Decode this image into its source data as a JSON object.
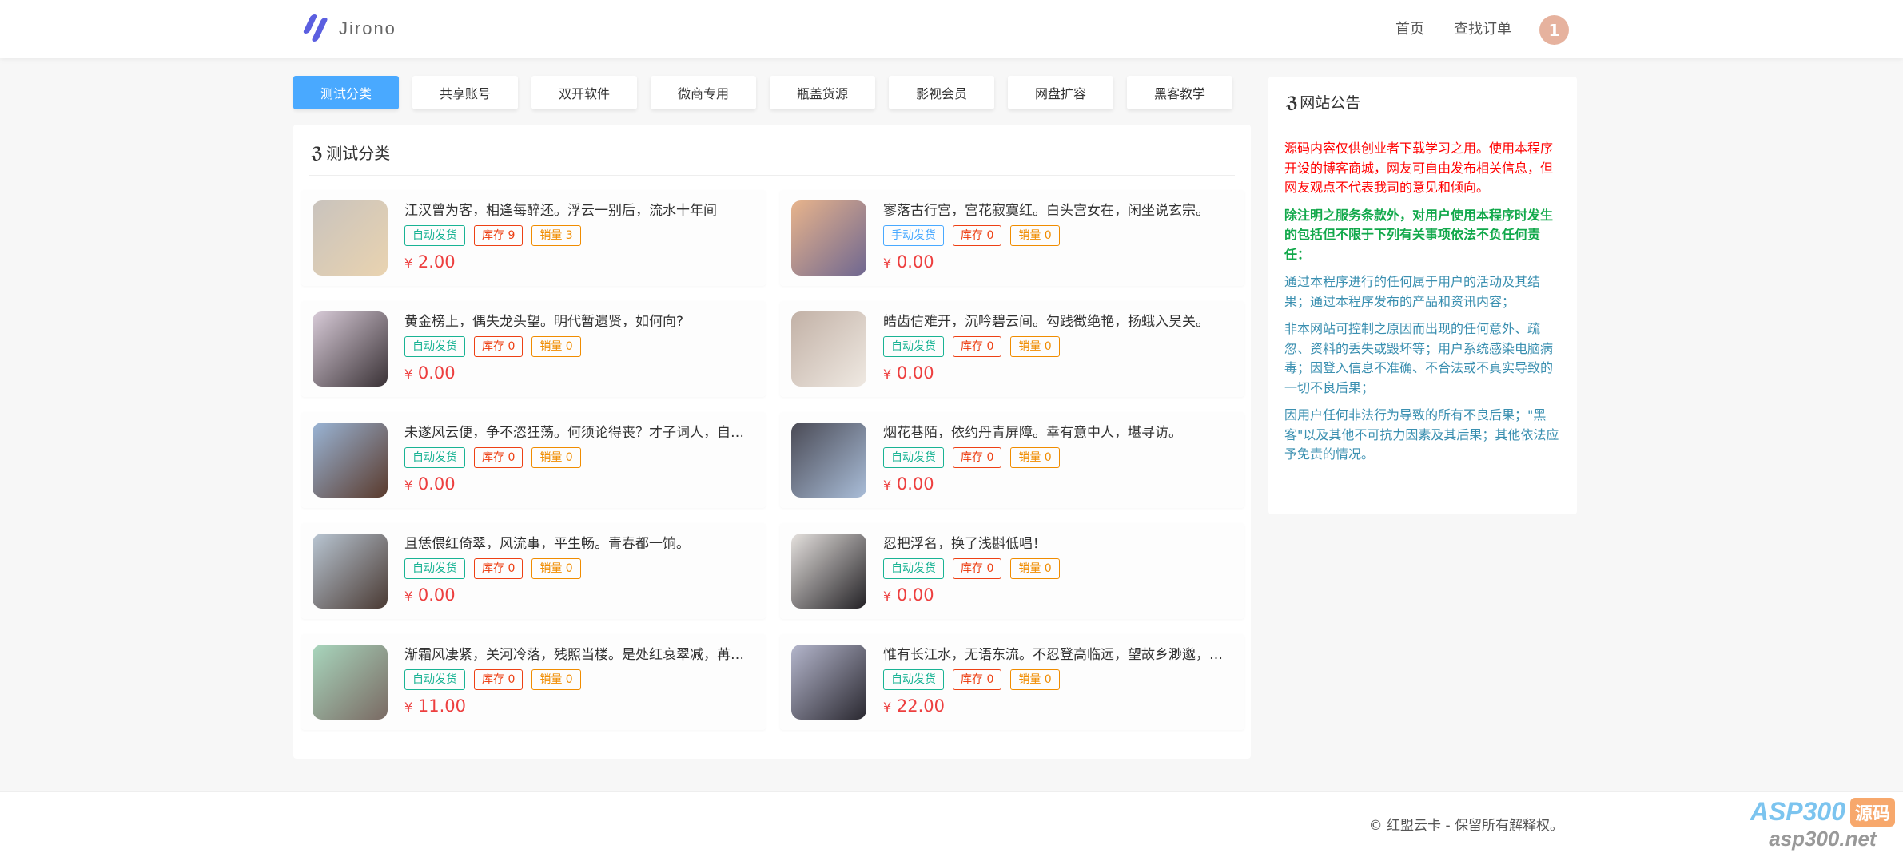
{
  "header": {
    "brand": "Jirono",
    "nav": [
      "首页",
      "查找订单"
    ],
    "avatar_text": "1"
  },
  "tabs": [
    {
      "label": "测试分类",
      "active": true
    },
    {
      "label": "共享账号"
    },
    {
      "label": "双开软件"
    },
    {
      "label": "微商专用"
    },
    {
      "label": "瓶盖货源"
    },
    {
      "label": "影视会员"
    },
    {
      "label": "网盘扩容"
    },
    {
      "label": "黑客教学"
    }
  ],
  "main": {
    "title_icon": "css3-icon",
    "title": "测试分类",
    "items": [
      {
        "title": "江汉曾为客，相逢每醉还。浮云一别后，流水十年间",
        "delivery": "自动发货",
        "delivery_type": "auto",
        "stock": "库存 9",
        "sales": "销量 3",
        "currency": "¥",
        "price": "2.00",
        "colors": [
          "#c9c3bd",
          "#e9d3b0"
        ]
      },
      {
        "title": "寥落古行宫，宫花寂寞红。白头宫女在，闲坐说玄宗。",
        "delivery": "手动发货",
        "delivery_type": "manual",
        "stock": "库存 0",
        "sales": "销量 0",
        "currency": "¥",
        "price": "0.00",
        "colors": [
          "#e8b48c",
          "#6f6790"
        ]
      },
      {
        "title": "黄金榜上，偶失龙头望。明代暂遗贤，如何向?",
        "delivery": "自动发货",
        "delivery_type": "auto",
        "stock": "库存 0",
        "sales": "销量 0",
        "currency": "¥",
        "price": "0.00",
        "colors": [
          "#d8cbd8",
          "#3a3236"
        ]
      },
      {
        "title": "皓齿信难开，沉吟碧云间。勾践徵绝艳，扬蛾入吴关。",
        "delivery": "自动发货",
        "delivery_type": "auto",
        "stock": "库存 0",
        "sales": "销量 0",
        "currency": "¥",
        "price": "0.00",
        "colors": [
          "#c2b1a6",
          "#efe9e2"
        ]
      },
      {
        "title": "未遂风云便，争不恣狂荡。何须论得丧？才子词人，自是白衣卿相。",
        "delivery": "自动发货",
        "delivery_type": "auto",
        "stock": "库存 0",
        "sales": "销量 0",
        "currency": "¥",
        "price": "0.00",
        "colors": [
          "#9ab5d6",
          "#5a3a2c"
        ]
      },
      {
        "title": "烟花巷陌，依约丹青屏障。幸有意中人，堪寻访。",
        "delivery": "自动发货",
        "delivery_type": "auto",
        "stock": "库存 0",
        "sales": "销量 0",
        "currency": "¥",
        "price": "0.00",
        "colors": [
          "#4a4a55",
          "#a9bdd8"
        ]
      },
      {
        "title": "且恁偎红倚翠，风流事，平生畅。青春都一饷。",
        "delivery": "自动发货",
        "delivery_type": "auto",
        "stock": "库存 0",
        "sales": "销量 0",
        "currency": "¥",
        "price": "0.00",
        "colors": [
          "#b9c6d3",
          "#4a3a33"
        ]
      },
      {
        "title": "忍把浮名，换了浅斟低唱！",
        "delivery": "自动发货",
        "delivery_type": "auto",
        "stock": "库存 0",
        "sales": "销量 0",
        "currency": "¥",
        "price": "0.00",
        "colors": [
          "#e5e1de",
          "#232125"
        ]
      },
      {
        "title": "渐霜风凄紧，关河冷落，残照当楼。是处红衰翠减，苒苒物华休。",
        "delivery": "自动发货",
        "delivery_type": "auto",
        "stock": "库存 0",
        "sales": "销量 0",
        "currency": "¥",
        "price": "11.00",
        "colors": [
          "#a8d6bd",
          "#7a6a63"
        ]
      },
      {
        "title": "惟有长江水，无语东流。不忍登高临远，望故乡渺邈，归思难收。",
        "delivery": "自动发货",
        "delivery_type": "auto",
        "stock": "库存 0",
        "sales": "销量 0",
        "currency": "¥",
        "price": "22.00",
        "colors": [
          "#b4b6cc",
          "#2a2830"
        ]
      }
    ]
  },
  "sidebar": {
    "title_icon": "css3-icon",
    "title": "网站公告",
    "paragraphs": [
      {
        "text": "源码内容仅供创业者下载学习之用。使用本程序开设的博客商城，网友可自由发布相关信息，但网友观点不代表我司的意见和倾向。",
        "color": "#ff0000",
        "bold": false
      },
      {
        "text": "除注明之服务条款外，对用户使用本程序时发生的包括但不限于下列有关事项依法不负任何责任：",
        "color": "#11a84a",
        "bold": true
      },
      {
        "text": "通过本程序进行的任何属于用户的活动及其结果；通过本程序发布的产品和资讯内容；",
        "color": "#3a8fb0",
        "bold": false
      },
      {
        "text": "非本网站可控制之原因而出现的任何意外、疏忽、资料的丢失或毁坏等；用户系统感染电脑病毒；因登入信息不准确、不合法或不真实导致的一切不良后果；",
        "color": "#3a8fb0",
        "bold": false
      },
      {
        "text": "因用户任何非法行为导致的所有不良后果；\"黑客\"以及其他不可抗力因素及其后果；其他依法应予免责的情况。",
        "color": "#3a8fb0",
        "bold": false
      }
    ]
  },
  "footer": {
    "copyright": "© 红盟云卡 - 保留所有解释权。"
  },
  "watermark": {
    "line1": "ASP300",
    "badge": "源码",
    "line2": "asp300.net"
  },
  "colors": {
    "accent": "#49a9ff",
    "auto": "#19b394",
    "manual": "#49a9ff",
    "stock": "#ed4014",
    "sales": "#f08c00",
    "price": "#ed3f3f",
    "logo": "#5b5fe0"
  }
}
